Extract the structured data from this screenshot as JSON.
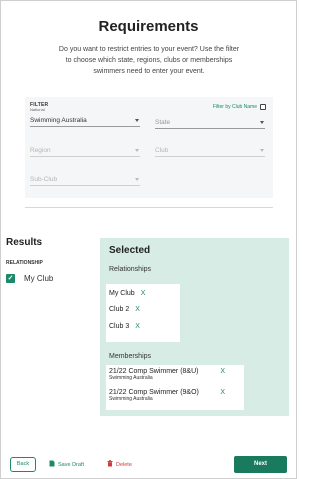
{
  "header": {
    "title": "Requirements",
    "description": "Do you want to restrict entries to your event? Use the filter to choose which state, regions, clubs or memberships swimmers need to enter your event."
  },
  "filter": {
    "heading": "FILTER",
    "filter_by_club_name_label": "Filter by Club Name",
    "filter_by_club_name_checked": false,
    "national": {
      "label": "National",
      "value": "Swimming Australia"
    },
    "state": {
      "value": "State"
    },
    "region": {
      "value": "Region"
    },
    "club": {
      "value": "Club"
    },
    "subclub": {
      "value": "Sub-Club"
    }
  },
  "results": {
    "title": "Results",
    "relationship_heading": "RELATIONSHIP",
    "items": [
      {
        "label": "My Club",
        "checked": true
      }
    ]
  },
  "selected": {
    "title": "Selected",
    "relationships_heading": "Relationships",
    "relationships": [
      {
        "label": "My Club",
        "remove": "X"
      },
      {
        "label": "Club 2",
        "remove": "X"
      },
      {
        "label": "Club 3",
        "remove": "X"
      }
    ],
    "memberships_heading": "Memberships",
    "memberships": [
      {
        "name": "21/22 Comp Swimmer (8&U)",
        "org": "Swimming Australia",
        "remove": "X"
      },
      {
        "name": "21/22 Comp Swimmer (9&O)",
        "org": "Swimming Australia",
        "remove": "X"
      }
    ]
  },
  "footer": {
    "back_label": "Back",
    "save_draft_label": "Save Draft",
    "delete_label": "Delete",
    "next_label": "Next"
  },
  "colors": {
    "accent": "#1a8a6b",
    "panel_bg": "#d7ece5",
    "filter_bg": "#f4f6f8",
    "delete": "#cc3b3b",
    "next_button": "#1a7a5e"
  }
}
